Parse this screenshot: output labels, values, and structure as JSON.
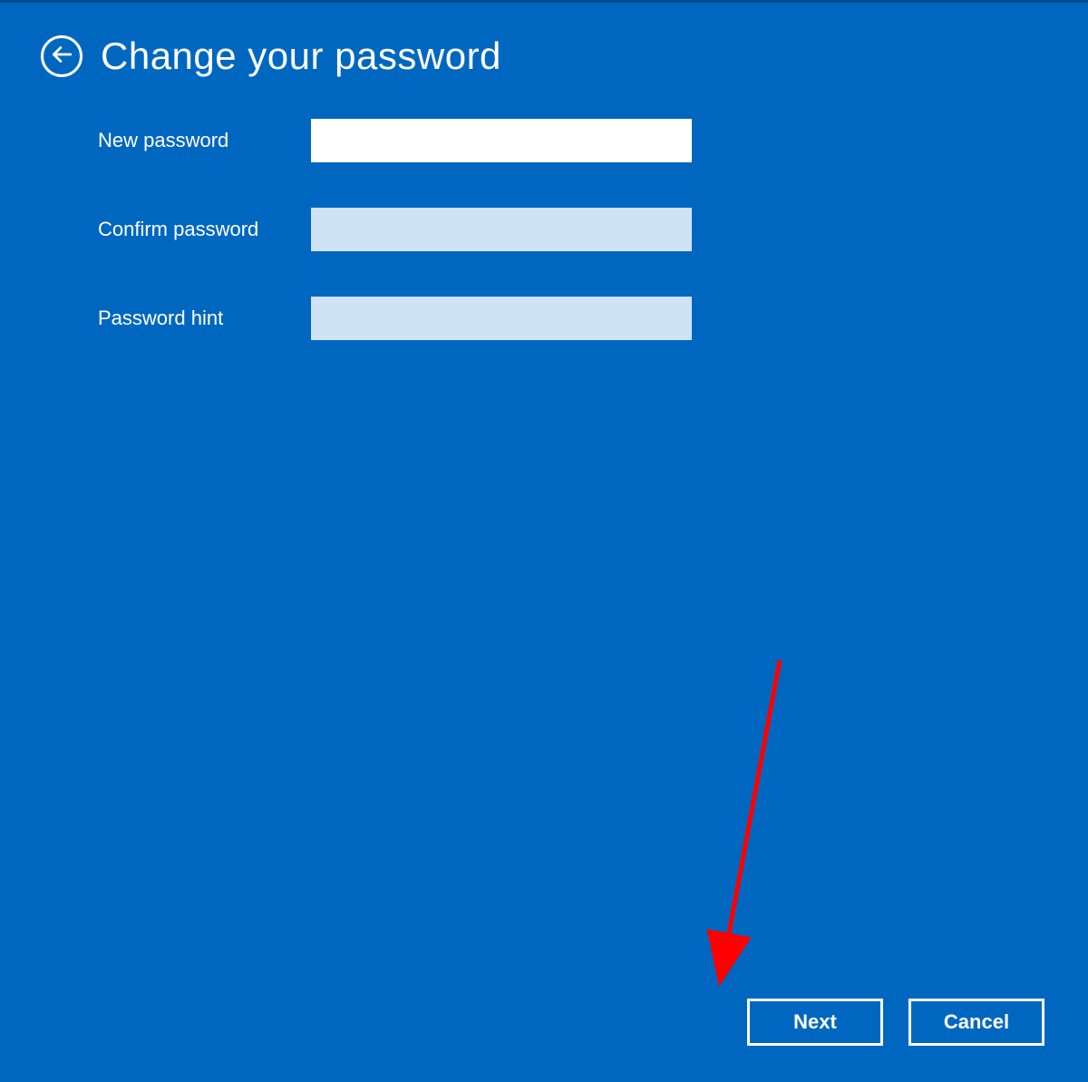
{
  "header": {
    "title": "Change your password"
  },
  "form": {
    "new_password": {
      "label": "New password",
      "value": ""
    },
    "confirm_password": {
      "label": "Confirm password",
      "value": ""
    },
    "password_hint": {
      "label": "Password hint",
      "value": ""
    }
  },
  "buttons": {
    "next": "Next",
    "cancel": "Cancel"
  }
}
